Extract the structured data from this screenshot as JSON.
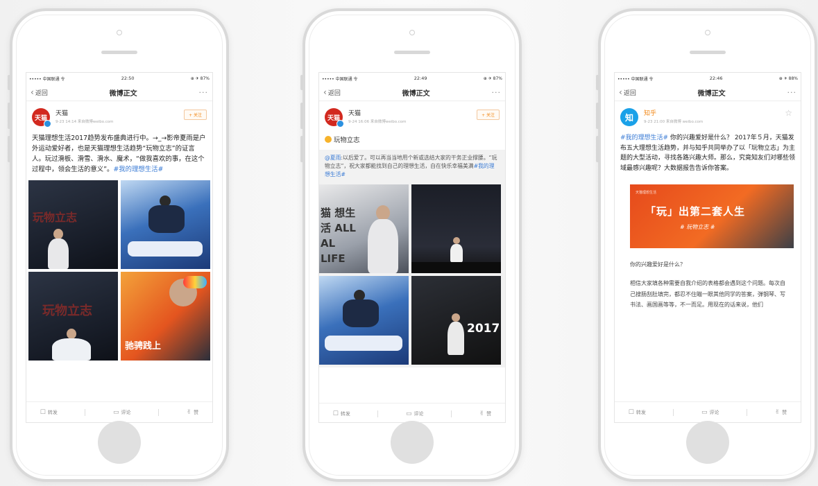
{
  "phones": [
    {
      "status": {
        "carrier": "••••• 中国联通 令",
        "time": "22:50",
        "battery": "⊕ ✈ 87%"
      },
      "nav": {
        "back": "返回",
        "title": "微博正文",
        "more": "···"
      },
      "author": {
        "name": "天猫",
        "avatar_text": "天猫",
        "meta": "9-23 14:14  来自微博weibo.com"
      },
      "follow": "+ 关注",
      "text": "天猫理想生活2017趋势发布盛典进行中。→_→影帝夏雨是户外运动爱好者，也是天猫理想生活趋势“玩物立志”的证言人。玩过滑板、滑雪、滑水、魔术，“做我喜欢的事，在这个过程中，领会生活的意义”。",
      "tag": "#我的理想生活#",
      "images": [
        "玩物立志",
        "",
        "玩物立志",
        "驰骋践上"
      ],
      "actions": {
        "repost": "转发",
        "comment": "评论",
        "like": "赞"
      }
    },
    {
      "status": {
        "carrier": "••••• 中国联通 令",
        "time": "22:49",
        "battery": "⊕ ✈ 87%"
      },
      "nav": {
        "back": "返回",
        "title": "微博正文",
        "more": "···"
      },
      "author": {
        "name": "天猫",
        "avatar_text": "天猫",
        "meta": "9-24 16:06  来自微博weibo.com"
      },
      "follow": "+ 关注",
      "topic": "玩物立志",
      "quote_at": "@夏雨",
      "quote_text": ":以后爱了。可以再当当地用个新或选结大家的干务正业撑腰。“玩物立志”，祝大家都能找到自己的理想生活，自在快乐幸福美满",
      "quote_tag": "#我的理想生活#",
      "images": [
        "猫 想生活 ALL AL LIFE",
        "",
        "",
        "2017"
      ],
      "actions": {
        "repost": "转发",
        "comment": "评论",
        "like": "赞"
      }
    },
    {
      "status": {
        "carrier": "••••• 中国联通 令",
        "time": "22:46",
        "battery": "⊕ ✈ 88%"
      },
      "nav": {
        "back": "返回",
        "title": "微博正文",
        "more": "···"
      },
      "author": {
        "name": "知乎",
        "avatar_text": "知",
        "meta": "9-23 21:00  来自微博 weibo.com"
      },
      "star": "☆",
      "tag": "#我的理想生活#",
      "text": " 你的兴趣爱好是什么？ 2017年５月，天猫发布五大理想生活趋势，并与知乎共同举办了以「玩物立志」为主题的大型活动，寻找各路兴趣大师。那么，究竟知友们对哪些领域最感兴趣呢？大数据报告告诉你答案。",
      "banner": {
        "title": "「玩」出第二套人生",
        "subtitle": "# 玩物立志 #",
        "brand": "天猫理想生活"
      },
      "article_q": "你的兴趣爱好是什么？",
      "article_p": "相信大家填各种需要自我介绍的表格都会遇到这个问题。每次自己搜肠刮肚填完，都忍不住瞄一眼其他同学的答案，弹钢琴、写书法、画国画等等，不一而足。用现在的话来说，他们",
      "actions": {
        "repost": "转发",
        "comment": "评论",
        "like": "赞"
      }
    }
  ],
  "colors": {
    "accent_orange": "#f28a1a",
    "link_blue": "#3a7bd5",
    "tmall_red": "#d2291f",
    "zhihu_blue": "#1aa1e8"
  }
}
